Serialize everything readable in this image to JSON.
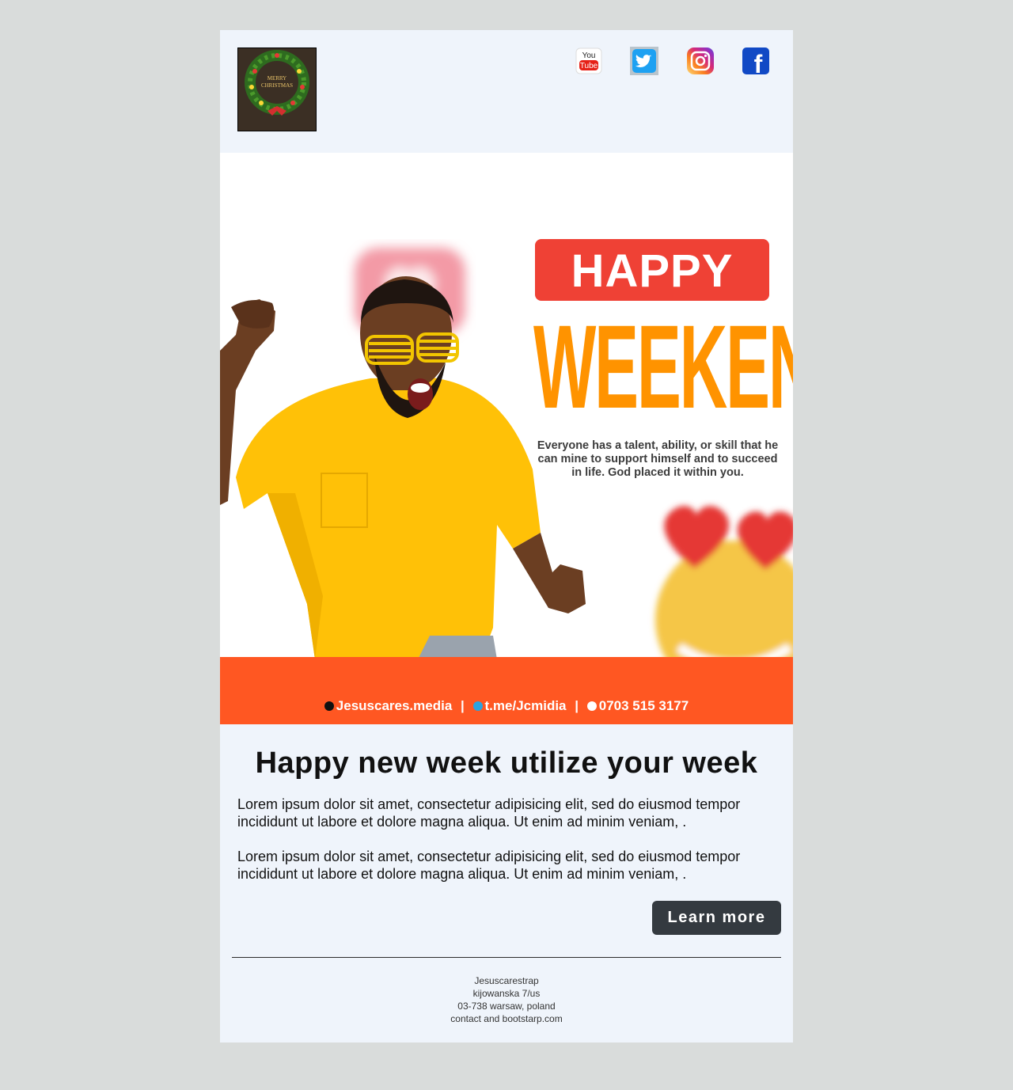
{
  "header": {
    "logo": {
      "text_line1": "MERRY",
      "text_line2": "CHRISTMAS"
    },
    "social": [
      {
        "name": "youtube",
        "icon": "youtube-icon",
        "label_top": "You",
        "label_bottom": "Tube"
      },
      {
        "name": "twitter",
        "icon": "twitter-icon"
      },
      {
        "name": "instagram",
        "icon": "instagram-icon"
      },
      {
        "name": "facebook",
        "icon": "facebook-icon",
        "glyph": "f"
      }
    ]
  },
  "banner": {
    "happy": "HAPPY",
    "weekend": "WEEKEND",
    "tagline": "Everyone has a talent, ability, or skill that he can mine to support himself and to succeed in life. God placed it within you.",
    "contacts": {
      "tiktok": "Jesuscares.media",
      "telegram": "t.me/Jcmidia",
      "phone": "0703 515 3177",
      "separator": "|"
    },
    "colors": {
      "happy_box": "#ef4135",
      "weekend_text": "#ff9300",
      "contact_bar": "#ff5722",
      "shirt": "#ffc107"
    }
  },
  "content": {
    "headline": "Happy new week utilize your week",
    "paragraph1": "Lorem ipsum dolor sit amet, consectetur adipisicing elit, sed do eiusmod tempor incididunt ut labore et dolore magna aliqua. Ut enim ad minim veniam, .",
    "paragraph2": "Lorem ipsum dolor sit amet, consectetur adipisicing elit, sed do eiusmod tempor incididunt ut labore et dolore magna aliqua. Ut enim ad minim veniam, .",
    "cta_label": "Learn more"
  },
  "footer": {
    "line1": "Jesuscarestrap",
    "line2": "kijowanska 7/us",
    "line3": "03-738 warsaw, poland",
    "line4": "contact and bootstarp.com"
  },
  "theme": {
    "page_bg": "#d9dcdb",
    "email_bg": "#eff4fb",
    "button_bg": "#343a40"
  }
}
